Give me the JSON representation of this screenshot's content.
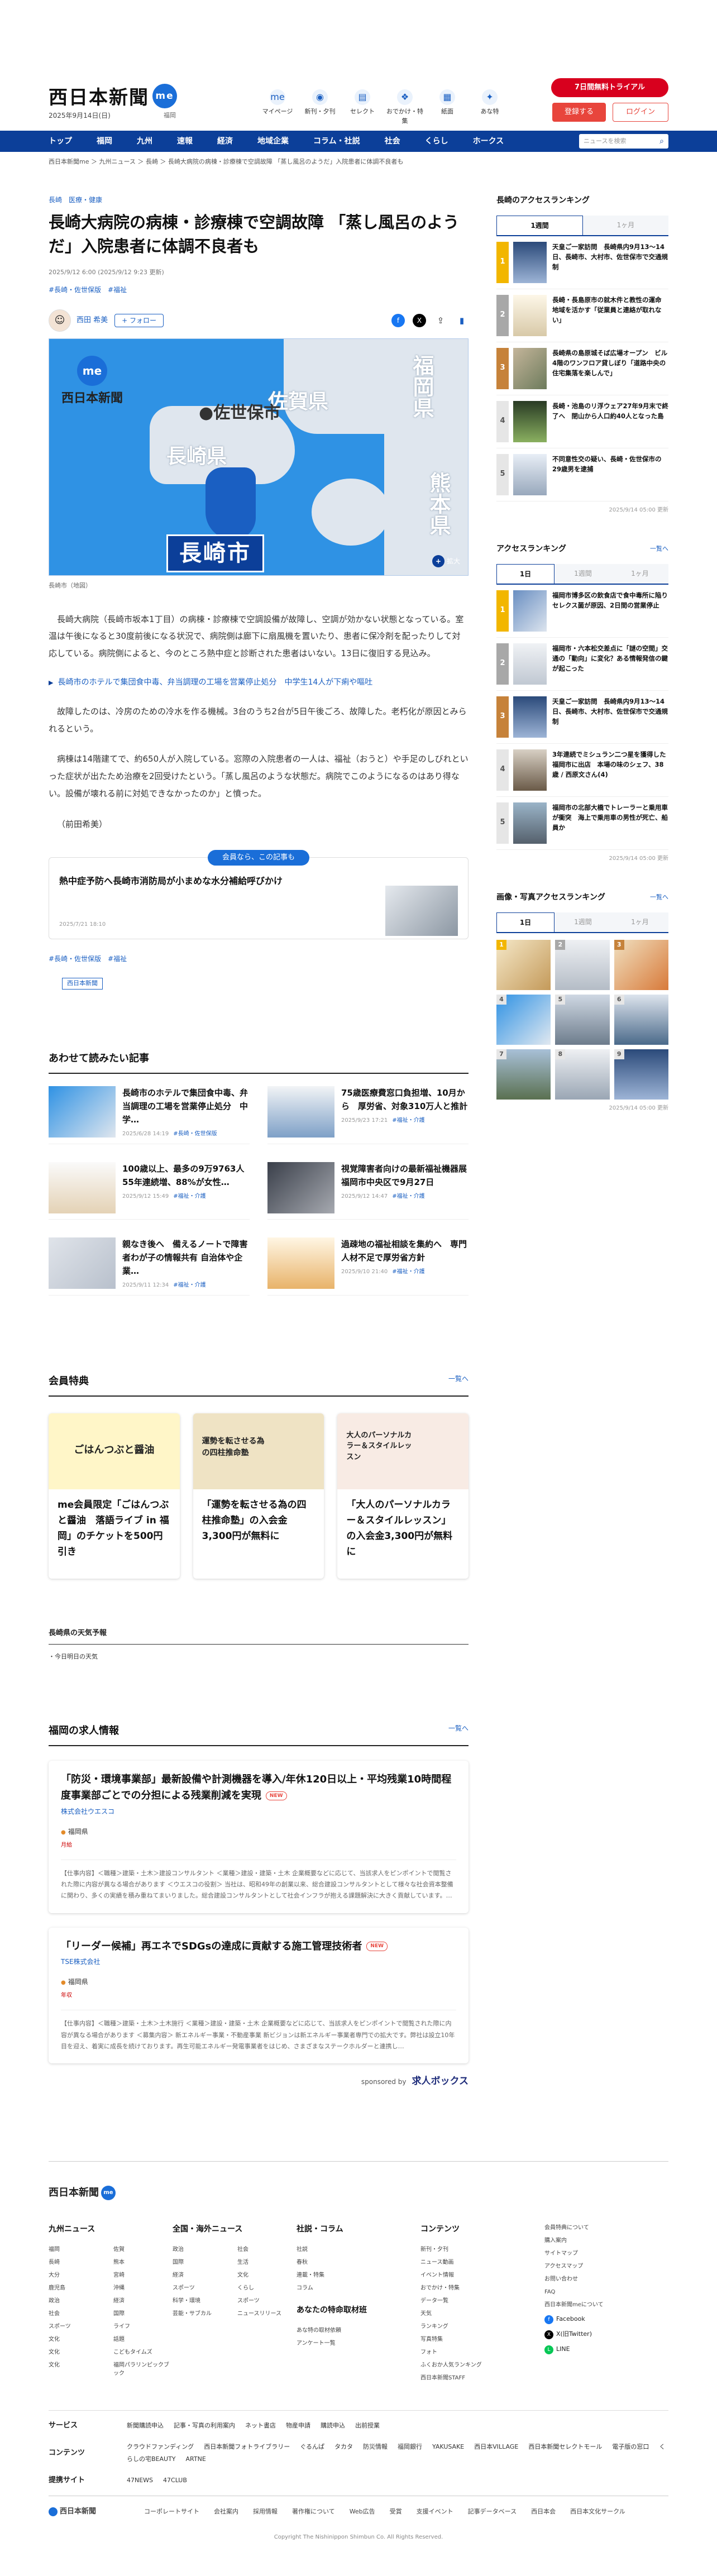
{
  "header": {
    "logo_text": "西日本新聞",
    "logo_badge": "me",
    "date": "2025年9月14日(日)",
    "area": "福岡",
    "nav": [
      {
        "label": "マイページ",
        "icon": "user-icon",
        "glyph": "me"
      },
      {
        "label": "新刊・夕刊",
        "icon": "newspaper-icon",
        "glyph": "◉"
      },
      {
        "label": "セレクト",
        "icon": "select-icon",
        "glyph": "▤"
      },
      {
        "label": "おでかけ・特集",
        "icon": "footprint-icon",
        "glyph": "❖"
      },
      {
        "label": "紙面",
        "icon": "paper-icon",
        "glyph": "▦"
      },
      {
        "label": "あな特",
        "icon": "team-icon",
        "glyph": "✦"
      }
    ],
    "trial_label": "7日間無料トライアル",
    "register_label": "登録する",
    "login_label": "ログイン"
  },
  "gnav": {
    "items": [
      "トップ",
      "福岡",
      "九州",
      "速報",
      "経済",
      "地域企業",
      "コラム・社説",
      "社会",
      "くらし",
      "ホークス"
    ],
    "search_placeholder": "ニュースを検索"
  },
  "breadcrumb": "西日本新聞me ＞ 九州ニュース ＞ 長崎 ＞ 長崎大病院の病棟・診療棟で空調故障 「蒸し風呂のようだ」入院患者に体調不良者も",
  "article": {
    "tags": "長崎　医療・健康",
    "title": "長崎大病院の病棟・診療棟で空調故障 「蒸し風呂のようだ」入院患者に体調不良者も",
    "meta": "2025/9/12 6:00 (2025/9/12 9:23 更新)",
    "keywords": "#長崎・佐世保版　#福祉",
    "author_name": "西田 希美",
    "follow_label": "+ フォロー",
    "map": {
      "logo": "西日本新聞",
      "badge": "me",
      "labels": [
        "福岡県",
        "佐賀県",
        "佐世保市",
        "長崎県",
        "熊本県"
      ],
      "city": "長崎市",
      "zoom_label": "拡大"
    },
    "caption": "長崎市（地図）",
    "paragraphs": [
      "長崎大病院（長崎市坂本1丁目）の病棟・診療棟で空調設備が故障し、空調が効かない状態となっている。室温は午後になると30度前後になる状況で、病院側は廊下に扇風機を置いたり、患者に保冷剤を配ったりして対応している。病院側によると、今のところ熱中症と診断された患者はいない。13日に復旧する見込み。",
      "故障したのは、冷房のための冷水を作る機械。3台のうち2台が5日午後ごろ、故障した。老朽化が原因とみられるという。",
      "病棟は14階建てで、約650人が入院している。窓際の入院患者の一人は、福祉（おうと）や手足のしびれといった症状が出たため治療を2回受けたという。「蒸し風呂のような状態だ。病院でこのようになるのはあり得ない。設備が壊れる前に対処できなかったのか」と憤った。",
      "（前田希美）"
    ],
    "related_link": "長崎市のホテルで集団食中毒、弁当調理の工場を営業停止処分　中学生14人が下痢や嘔吐",
    "member_box": {
      "tag": "会員なら、この記事も",
      "title": "熱中症予防へ長崎市消防局が小まめな水分補給呼びかけ",
      "date": "2025/7/21 18:10"
    },
    "keywords2": "#長崎・佐世保版　#福祉",
    "publisher": "西日本新聞"
  },
  "recommended": {
    "heading": "あわせて読みたい記事",
    "items": [
      {
        "title": "長崎市のホテルで集団食中毒、弁当調理の工場を営業停止処分　中学…",
        "date": "2025/6/28 14:19",
        "tag": "#長崎・佐世保版"
      },
      {
        "title": "75歳医療費窓口負担増、10月から　厚労省、対象310万人と推計",
        "date": "2025/9/23 17:21",
        "tag": "#福祉・介護"
      },
      {
        "title": "100歳以上、最多の9万9763人　55年連続増、88%が女性…",
        "date": "2025/9/12 15:49",
        "tag": "#福祉・介護"
      },
      {
        "title": "視覚障害者向けの最新福祉機器展　福岡市中央区で9月27日",
        "date": "2025/9/12 14:47",
        "tag": "#福祉・介護"
      },
      {
        "title": "親なき後へ　備えるノートで障害者わが子の情報共有 自治体や企業…",
        "date": "2025/9/11 12:34",
        "tag": "#福祉・介護"
      },
      {
        "title": "過疎地の福祉相談を集約へ　専門人材不足で厚労省方針",
        "date": "2025/9/10 21:40",
        "tag": "#福祉・介護"
      }
    ]
  },
  "benefits": {
    "heading": "会員特典",
    "more": "一覧へ",
    "cards": [
      "me会員限定「ごはんつぶと醤油　落語ライブ in 福岡」のチケットを500円引き",
      "「運勢を転させる為の四柱推命塾」の入会金3,300円が無料に",
      "「大人のパーソナルカラー＆スタイルレッスン」の入会金3,300円が無料に"
    ],
    "card_texts": [
      "ごはんつぶと醤油",
      "運勢を転させる為の四柱推命塾",
      "大人のパーソナルカラー＆スタイルレッスン"
    ]
  },
  "weather": {
    "heading": "長崎県の天気予報",
    "item": "今日明日の天気"
  },
  "jobs": {
    "heading": "福岡の求人情報",
    "more": "一覧へ",
    "new_label": "NEW",
    "location": "福岡県",
    "items": [
      {
        "title": "「防災・環境事業部」最新設備や計測機器を導入/年休120日以上・平均残業10時間程度事業部ごとでの分担による残業削減を実現",
        "company": "株式会社ウエスコ",
        "salary": "月給",
        "desc": "【仕事内容】＜職種＞建築・土木＞建設コンサルタント ＜業種＞建設・建築・土木 企業概要などに応じて、当該求人をピンポイントで閲覧された際に内容が異なる場合があります ＜ウエスコの役割＞ 当社は、昭和49年の創業以来、総合建設コンサルタントとして様々な社会資本整備に関わり、多くの実績を積み重ねてまいりました。総合建設コンサルタントとして社会インフラが抱える課題解決に大きく貢献しています。…"
      },
      {
        "title": "「リーダー候補」再エネでSDGsの達成に貢献する施工管理技術者",
        "company": "TSE株式会社",
        "salary": "年収",
        "desc": "【仕事内容】＜職種＞建築・土木＞土木施行 ＜業種＞建設・建築・土木 企業概要などに応じて、当該求人をピンポイントで閲覧された際に内容が異なる場合があります ＜募集内容＞ 新エネルギー事業・不動産事業 新ビジョンは新エネルギー事業者専門での拡大です。弊社は設立10年目を迎え、着実に成長を続けております。再生可能エネルギー発電事業者をはじめ、さまざまなステークホルダーと連携し…"
      }
    ],
    "sponsor": "sponsored by",
    "sponsor_brand": "求人ボックス"
  },
  "sidebar": {
    "ranking": {
      "heading": "長崎のアクセスランキング",
      "tabs": [
        "1週間",
        "1ヶ月"
      ],
      "items": [
        "天皇ご一家訪問　長崎県内9月13〜14日、長崎市、大村市、佐世保市で交通規制",
        "長崎・長島原市の就木件と教性の運命　地域を活かす「従業員と連絡が取れない」",
        "長崎県の島原城そば広場オープン　ビル4階のワンフロア貸しぼり「道路中央の住宅集落を楽しんで」",
        "長崎・池島のリ浮ウェア27年9月末で終了へ　閉山から人口約40人となった島",
        "不同意性交の疑い、長崎・佐世保市の29歳男を逮捕"
      ],
      "updated": "2025/9/14 05:00 更新"
    },
    "access": {
      "heading": "アクセスランキング",
      "more": "一覧へ",
      "tabs": [
        "1日",
        "1週間",
        "1ヶ月"
      ],
      "items": [
        "福岡市博多区の飲食店で食中毒所に陥りセレクス菌が原因、2日間の営業停止",
        "福岡市・六本松交差点に「謎の空間」交通の「動向」に変化？ある情報発信の鍵が起こった",
        "天皇ご一家訪問　長崎県内9月13〜14日、長崎市、大村市、佐世保市で交通規制",
        "3年連続でミシュラン二つ星を獲得した福岡市に出店　本場の味のシェフ、38歳 / 西原文さん(4)",
        "福岡市の北部大橋でトレーラーと乗用車が衝突　海上で乗用車の男性が死亡、船員か"
      ],
      "updated": "2025/9/14 05:00 更新"
    },
    "photo": {
      "heading": "画像・写真アクセスランキング",
      "more": "一覧へ",
      "tabs": [
        "1日",
        "1週間",
        "1ヶ月"
      ],
      "updated": "2025/9/14 05:00 更新"
    }
  },
  "footer": {
    "logo": "西日本新聞",
    "columns": [
      {
        "heading": "九州ニュース",
        "items": [
          "福岡",
          "佐賀",
          "長崎",
          "熊本",
          "大分",
          "宮崎",
          "鹿児島",
          "沖縄",
          "政治",
          "経済",
          "社会",
          "国際",
          "スポーツ",
          "ライフ",
          "文化",
          "話題",
          "文化",
          "こどもタイムズ",
          "文化",
          "福岡パラリンピックブック"
        ]
      },
      {
        "heading": "全国・海外ニュース",
        "items": [
          "政治",
          "社会",
          "国際",
          "生活",
          "経済",
          "文化",
          "スポーツ",
          "くらし",
          "科学・環境",
          "スポーツ",
          "芸能・サブカル",
          "ニュースリリース"
        ]
      },
      {
        "heading": "社説・コラム",
        "items": [
          "社説",
          "春秋",
          "連載・特集",
          "コラム"
        ],
        "sub_heading": "あなたの特命取材班",
        "sub_items": [
          "あな特の取材依頼",
          "アンケート一覧"
        ]
      },
      {
        "heading": "コンテンツ",
        "items": [
          "新刊・夕刊",
          "ニュース動画",
          "イベント情報",
          "おでかけ・特集",
          "データ一覧",
          "天気",
          "ランキング",
          "写真特集",
          "フォト",
          "ふくおか人気ランキング",
          "西日本新聞STAFF"
        ]
      },
      {
        "heading": "",
        "items": [
          "会員特典について",
          "購入案内",
          "サイトマップ",
          "アクセスマップ",
          "お問い合わせ",
          "FAQ",
          "西日本新聞meについて"
        ],
        "social": [
          "Facebook",
          "X(旧Twitter)",
          "LINE"
        ]
      }
    ],
    "rows": [
      {
        "heading": "サービス",
        "items": [
          "新聞購読申込",
          "記事・写真の利用案内",
          "ネット書店",
          "物産申請",
          "購読申込",
          "出前授業"
        ]
      },
      {
        "heading": "コンテンツ",
        "items": [
          "クラウドファンディング",
          "西日本新聞フォトライブラリー",
          "ぐるんぱ",
          "タカタ",
          "防災情報",
          "福岡銀行",
          "YAKUSAKE",
          "西日本VILLAGE",
          "西日本新聞セレクトモール",
          "電子版の窓口",
          "くらしの宅BEAUTY",
          "ARTNE"
        ]
      },
      {
        "heading": "提携サイト",
        "items": [
          "47NEWS",
          "47CLUB"
        ]
      }
    ],
    "bottom": [
      "コーポレートサイト",
      "会社案内",
      "採用情報",
      "著作権について",
      "Web広告",
      "受賞",
      "支援イベント",
      "記事データベース",
      "西日本会",
      "西日本文化サークル"
    ],
    "copyright": "Copyright The Nishinippon Shimbun Co. All Rights Reserved."
  }
}
